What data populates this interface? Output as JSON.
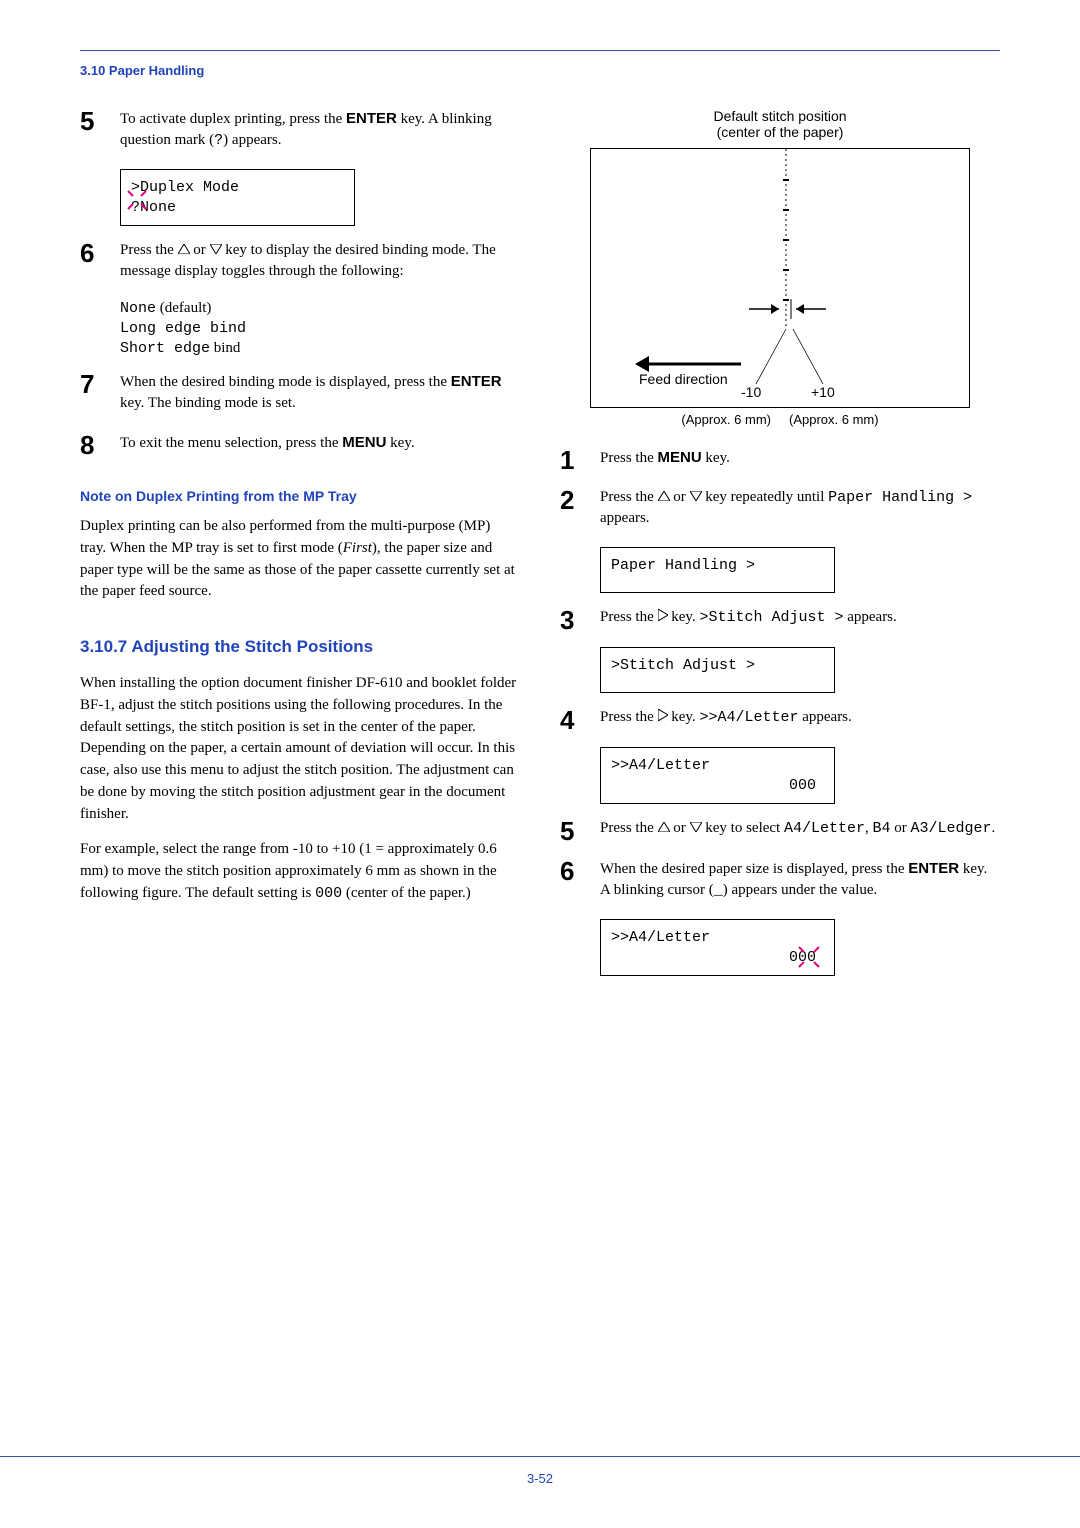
{
  "header": {
    "section": "3.10 Paper Handling"
  },
  "left": {
    "step5": {
      "text_a": "To activate duplex printing, press the ",
      "text_b": " key. A blinking question mark (",
      "text_c": ") appears.",
      "key": "ENTER",
      "qmark": "?",
      "lcd_l1": ">Duplex Mode",
      "lcd_l2": "?None"
    },
    "step6": {
      "text_a": "Press the ",
      "text_b": " or ",
      "text_c": " key to display the desired binding mode. The message display toggles through the following:",
      "list1a": "None",
      "list1b": " (default)",
      "list2": "Long edge bind",
      "list3": "Short edge",
      "list3b": " bind"
    },
    "step7": {
      "text_a": "When the desired binding mode is displayed, press the ",
      "text_b": " key. The binding mode is set.",
      "key": "ENTER"
    },
    "step8": {
      "text_a": "To exit the menu selection, press the ",
      "text_b": " key.",
      "key": "MENU"
    },
    "note_heading": "Note on Duplex Printing from the MP Tray",
    "note_body_a": "Duplex printing can be also performed from the multi-purpose (MP) tray. When the MP tray is set to first mode (",
    "note_body_b": "First",
    "note_body_c": "), the paper size and paper type will be the same as those of the paper cassette currently set at the paper feed source.",
    "section_heading": "3.10.7    Adjusting the Stitch Positions",
    "para1": "When installing the option document finisher DF-610 and booklet folder BF-1, adjust the stitch positions using the following procedures. In the default settings, the stitch position is set in the center of the paper. Depending on the paper, a certain amount of deviation will occur. In this case, also use this menu to adjust the stitch position. The adjustment can be done by moving the stitch position adjustment gear in the document finisher.",
    "para2_a": "For example, select the range from -10 to +10 (1 = approximately 0.6 mm) to move the stitch position approximately 6 mm as shown in the following figure. The default setting is ",
    "para2_b": "000",
    "para2_c": " (center of the paper.)"
  },
  "right": {
    "diagram": {
      "title_l1": "Default stitch position",
      "title_l2": "(center of the paper)",
      "feed": "Feed direction",
      "minus": "-10",
      "plus": "+10",
      "approx_l": "(Approx. 6 mm)",
      "approx_r": "(Approx. 6 mm)"
    },
    "step1": {
      "text_a": "Press the ",
      "text_b": " key.",
      "key": "MENU"
    },
    "step2": {
      "text_a": "Press the ",
      "text_b": " or ",
      "text_c": " key repeatedly until ",
      "code": "Paper Handling >",
      "text_d": " appears.",
      "lcd": "Paper Handling >"
    },
    "step3": {
      "text_a": "Press the ",
      "text_b": " key. ",
      "code": ">Stitch Adjust >",
      "text_c": " appears.",
      "lcd": ">Stitch Adjust >"
    },
    "step4": {
      "text_a": "Press the ",
      "text_b": " key. ",
      "code": ">>A4/Letter",
      "text_c": " appears.",
      "lcd_l1": ">>A4/Letter",
      "lcd_l2": "000"
    },
    "step5": {
      "text_a": "Press the ",
      "text_b": " or ",
      "text_c": " key to select ",
      "code1": "A4/Letter",
      "code2": "B4",
      "code3": "A3/Ledger",
      "text_d": ", ",
      "text_e": " or ",
      "text_f": "."
    },
    "step6": {
      "text_a": "When the desired paper size is displayed, press the ",
      "key": "ENTER",
      "text_b": " key. A blinking cursor (",
      "cursor": "_",
      "text_c": ") appears under the value.",
      "lcd_l1": ">>A4/Letter",
      "lcd_l2": "000"
    }
  },
  "footer": {
    "page": "3-52"
  }
}
